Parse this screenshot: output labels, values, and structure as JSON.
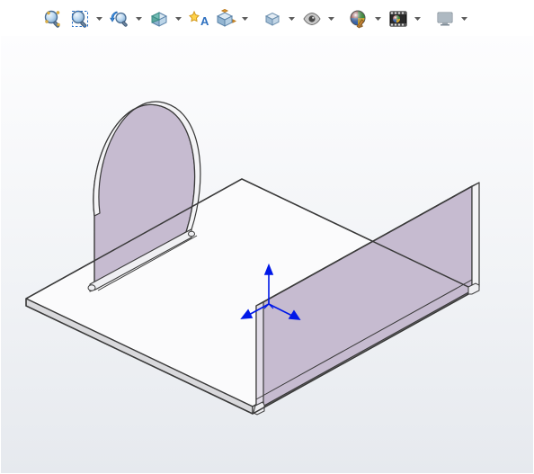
{
  "toolbar": {
    "items": [
      {
        "name": "zoom-to-fit-icon",
        "tip": "Zoom to Fit",
        "dropdown": false
      },
      {
        "name": "zoom-area-icon",
        "tip": "Zoom to Area",
        "dropdown": true
      },
      {
        "name": "previous-view-icon",
        "tip": "Previous View",
        "dropdown": true
      },
      {
        "name": "section-view-icon",
        "tip": "Section View",
        "dropdown": true
      },
      {
        "name": "dynamic-annotation-icon",
        "tip": "Dynamic Annotation Views",
        "dropdown": false
      },
      {
        "name": "view-orientation-icon",
        "tip": "View Orientation",
        "dropdown": true
      },
      {
        "name": "display-style-icon",
        "tip": "Display Style",
        "dropdown": true
      },
      {
        "name": "hide-show-icon",
        "tip": "Hide/Show Items",
        "dropdown": true
      },
      {
        "name": "edit-appearance-icon",
        "tip": "Edit Appearance",
        "dropdown": true
      },
      {
        "name": "apply-scene-icon",
        "tip": "Apply Scene",
        "dropdown": true
      },
      {
        "name": "view-settings-icon",
        "tip": "View Settings",
        "dropdown": true
      }
    ]
  },
  "viewport": {
    "triad": {
      "axes": [
        "X",
        "Y",
        "Z"
      ]
    },
    "model": "sheet-metal-bracket"
  }
}
